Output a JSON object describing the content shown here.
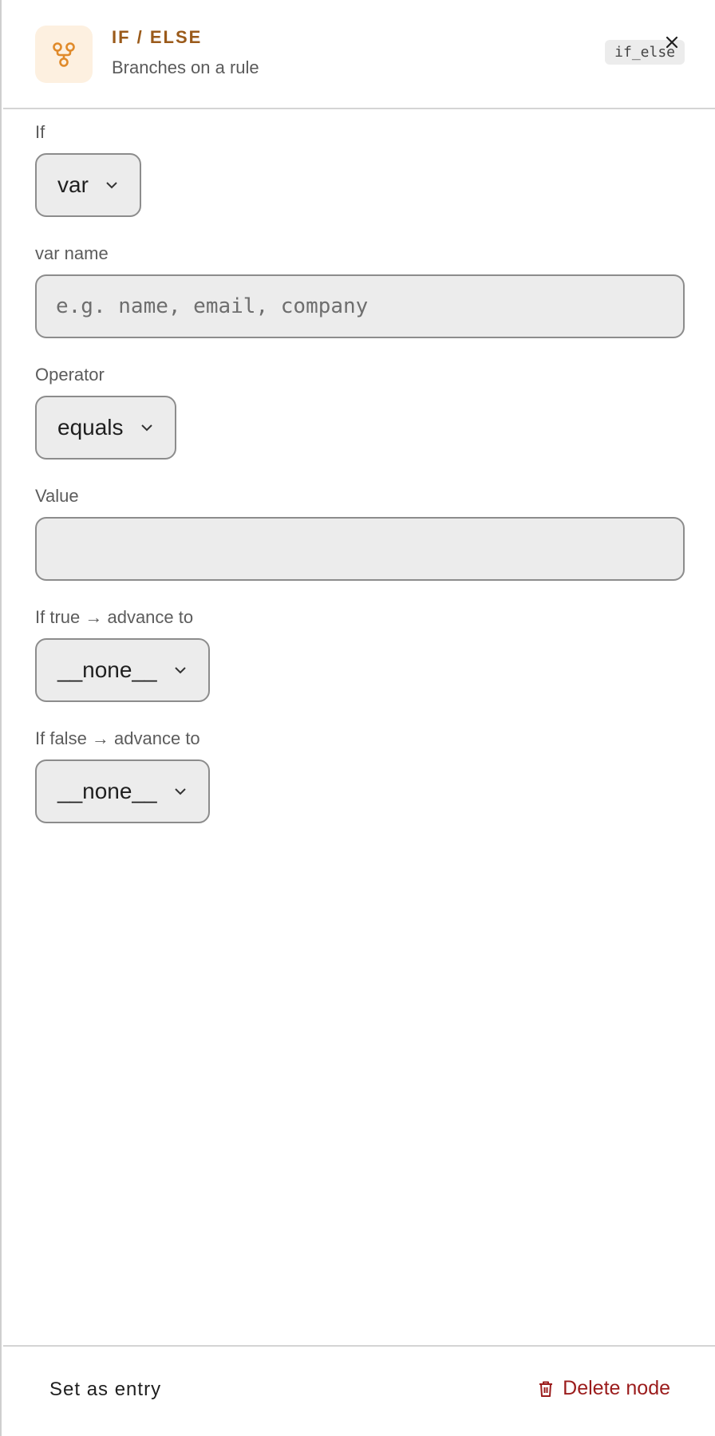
{
  "header": {
    "node_type": "IF / ELSE",
    "description": "Branches on a rule",
    "node_key": "if_else",
    "icon": "branch-icon",
    "accent_color": "#e08a2a"
  },
  "form": {
    "if_label": "If",
    "if_value": "var",
    "var_name_label": "var name",
    "var_name_placeholder": "e.g. name, email, company",
    "var_name_value": "",
    "operator_label": "Operator",
    "operator_value": "equals",
    "value_label": "Value",
    "value_value": "",
    "true_label": "If true → advance to",
    "true_value": "__none__",
    "false_label": "If false → advance to",
    "false_value": "__none__"
  },
  "footer": {
    "entry_label": "Set as entry",
    "delete_label": "Delete node",
    "delete_color": "#9b1c1c"
  }
}
